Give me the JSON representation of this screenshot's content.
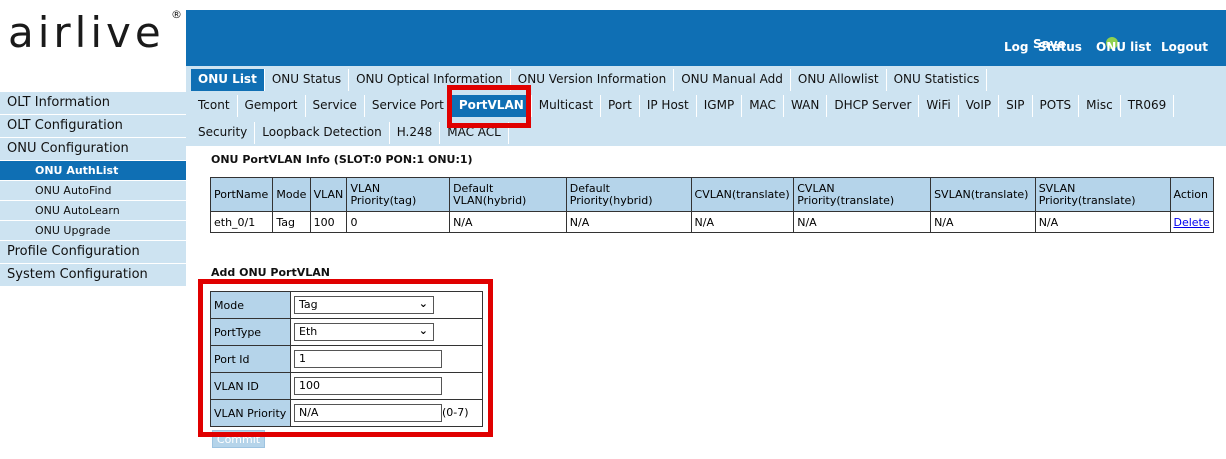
{
  "logo": {
    "text": "airlive",
    "reg": "®"
  },
  "topbar": {
    "save": "Save",
    "status_dot_color": "#8fd14f",
    "links": [
      "Log",
      "Status",
      "ONU list",
      "Logout"
    ]
  },
  "tabs": {
    "row1": [
      "ONU List",
      "ONU Status",
      "ONU Optical Information",
      "ONU Version Information",
      "ONU Manual Add",
      "ONU Allowlist",
      "ONU Statistics"
    ],
    "row2": [
      "Tcont",
      "Gemport",
      "Service",
      "Service Port",
      "PortVLAN",
      "Multicast",
      "Port",
      "IP Host",
      "IGMP",
      "MAC",
      "WAN",
      "DHCP Server",
      "WiFi",
      "VoIP",
      "SIP",
      "POTS",
      "Misc",
      "TR069"
    ],
    "row3": [
      "Security",
      "Loopback Detection",
      "H.248",
      "MAC ACL"
    ]
  },
  "sidebar": {
    "items": [
      "OLT Information",
      "OLT Configuration",
      "ONU Configuration"
    ],
    "sub": [
      "ONU AuthList",
      "ONU AutoFind",
      "ONU AutoLearn",
      "ONU Upgrade"
    ],
    "bottom": [
      "Profile Configuration",
      "System Configuration"
    ]
  },
  "info": {
    "title": "ONU PortVLAN Info (SLOT:0 PON:1 ONU:1)",
    "headers": [
      "PortName",
      "Mode",
      "VLAN",
      "VLAN Priority(tag)",
      "Default VLAN(hybrid)",
      "Default Priority(hybrid)",
      "CVLAN(translate)",
      "CVLAN Priority(translate)",
      "SVLAN(translate)",
      "SVLAN Priority(translate)",
      "Action"
    ],
    "row": [
      "eth_0/1",
      "Tag",
      "100",
      "0",
      "N/A",
      "N/A",
      "N/A",
      "N/A",
      "N/A",
      "N/A",
      "Delete"
    ]
  },
  "add": {
    "title": "Add ONU PortVLAN",
    "mode_label": "Mode",
    "mode_value": "Tag",
    "porttype_label": "PortType",
    "porttype_value": "Eth",
    "portid_label": "Port Id",
    "portid_value": "1",
    "vlanid_label": "VLAN ID",
    "vlanid_value": "100",
    "vlanpri_label": "VLAN Priority",
    "vlanpri_value": "N/A",
    "vlanpri_range": "(0-7)",
    "commit": "Commit"
  },
  "colors": {
    "accent": "#0f6fb4",
    "tab_bg": "#cde3f1",
    "header_bg": "#b5d4ea",
    "highlight": "#e00000"
  }
}
